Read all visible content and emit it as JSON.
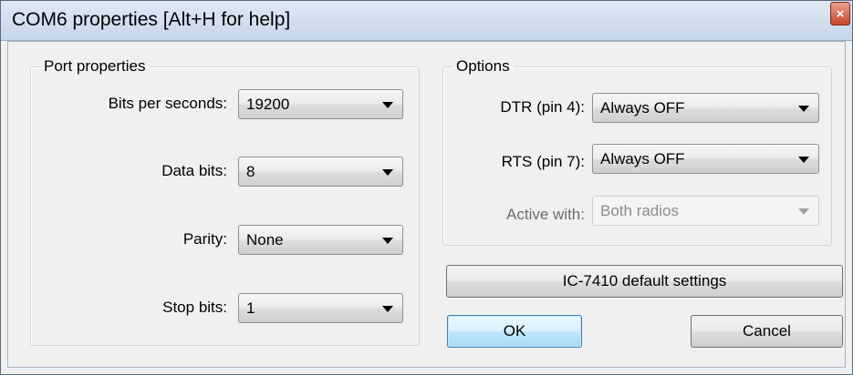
{
  "window": {
    "title": "COM6 properties [Alt+H for help]",
    "close_glyph": "×"
  },
  "port_properties": {
    "legend": "Port properties",
    "bits_per_second": {
      "label": "Bits per seconds:",
      "value": "19200"
    },
    "data_bits": {
      "label": "Data bits:",
      "value": "8"
    },
    "parity": {
      "label": "Parity:",
      "value": "None"
    },
    "stop_bits": {
      "label": "Stop bits:",
      "value": "1"
    }
  },
  "options": {
    "legend": "Options",
    "dtr": {
      "label": "DTR (pin 4):",
      "value": "Always OFF"
    },
    "rts": {
      "label": "RTS (pin 7):",
      "value": "Always OFF"
    },
    "active_with": {
      "label": "Active with:",
      "value": "Both radios",
      "disabled": true
    }
  },
  "buttons": {
    "defaults": "IC-7410 default settings",
    "ok": "OK",
    "cancel": "Cancel"
  },
  "colors": {
    "default_button_accent": "#3c7fb1",
    "close_button": "#c7432b"
  }
}
